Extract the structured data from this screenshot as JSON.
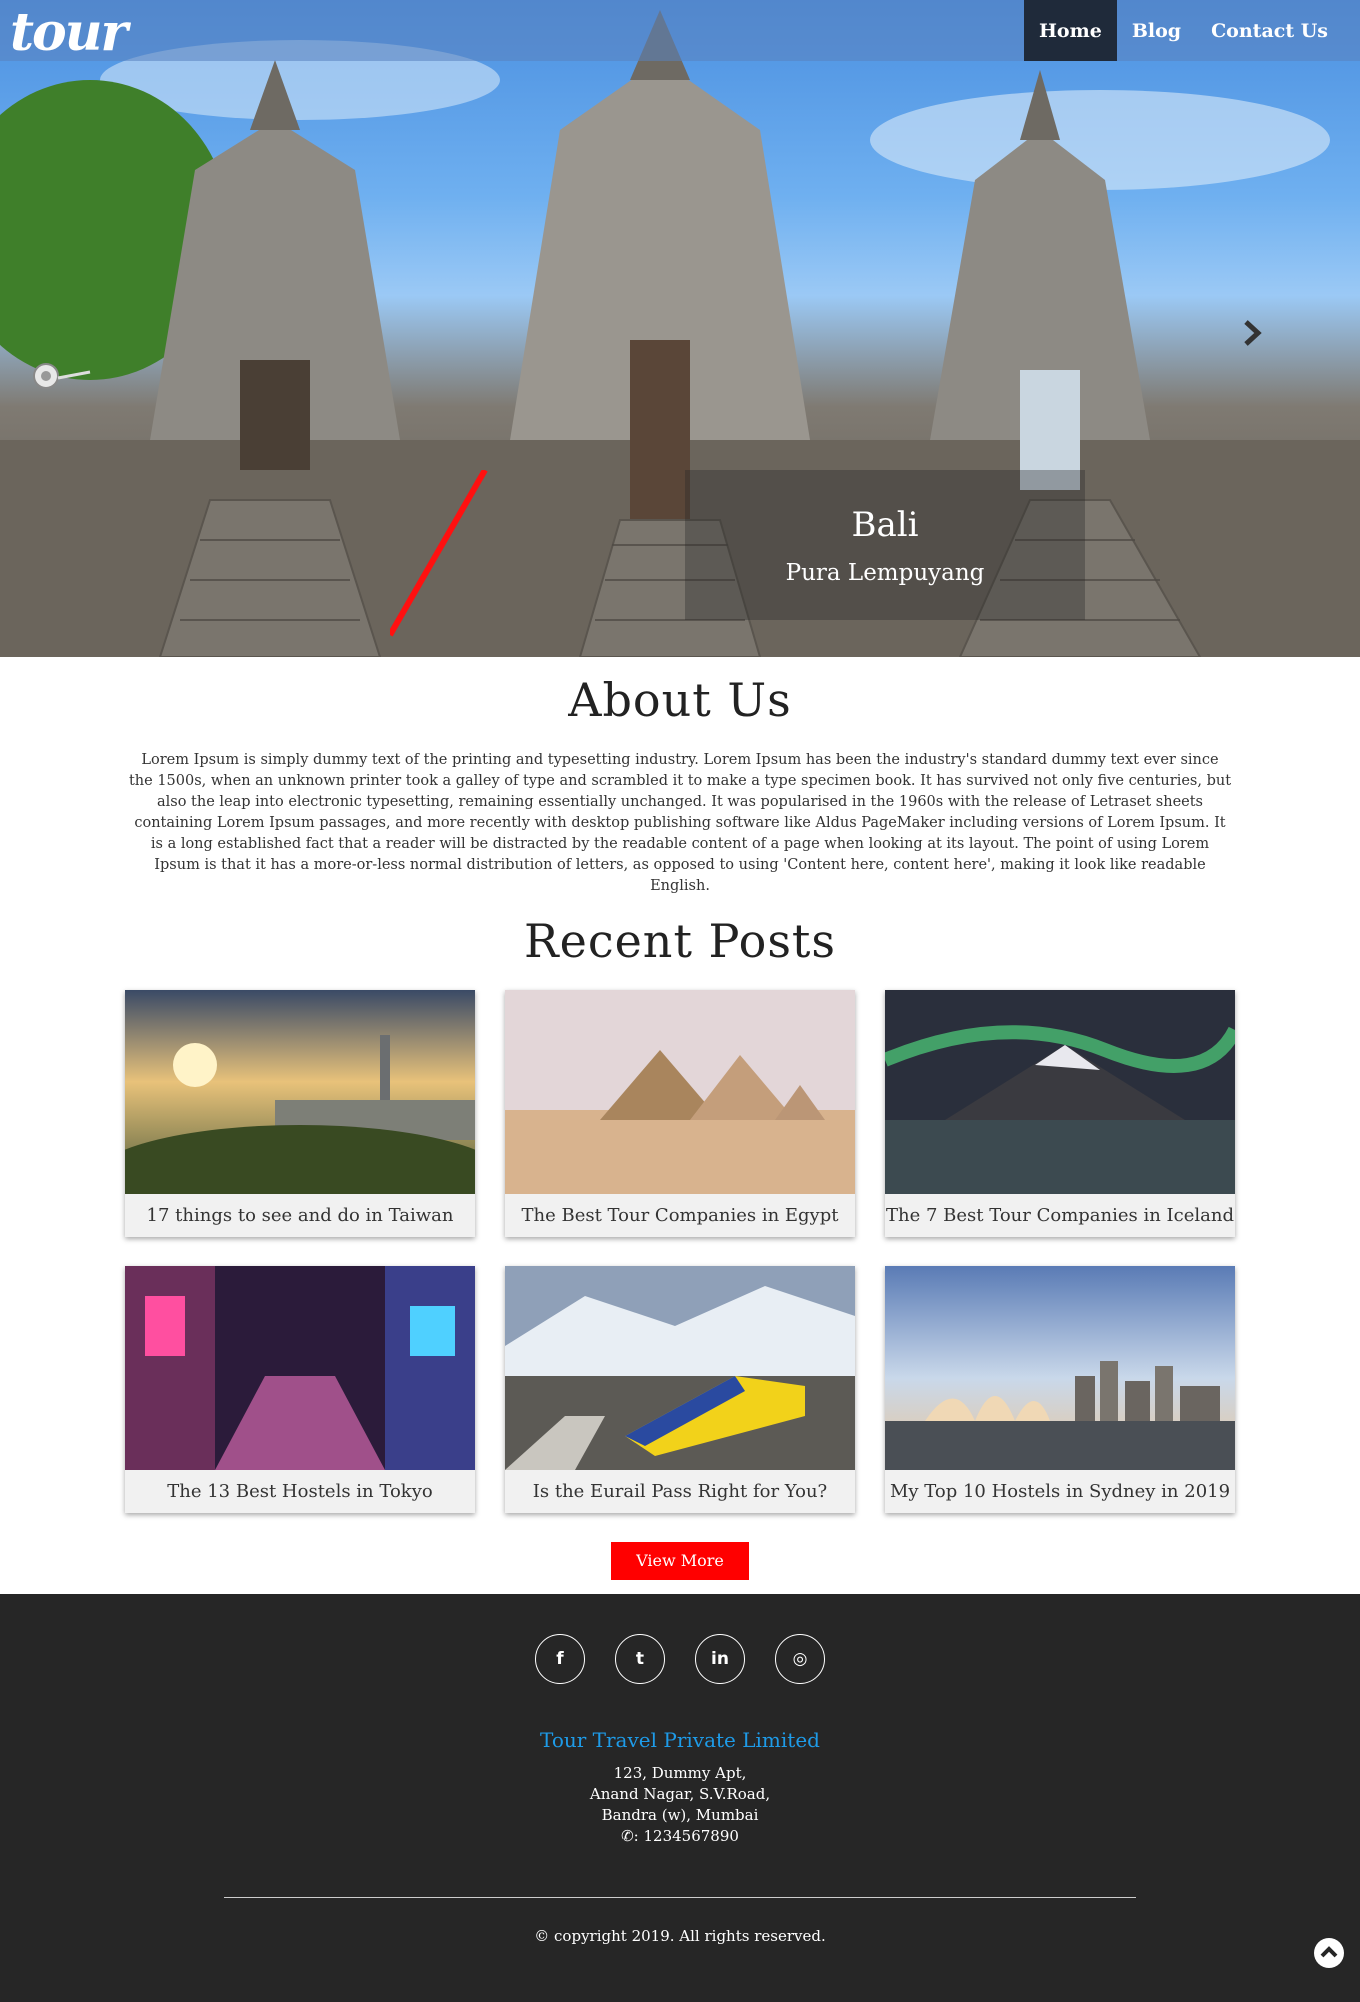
{
  "header": {
    "logo": "tour",
    "nav": [
      {
        "label": "Home"
      },
      {
        "label": "Blog"
      },
      {
        "label": "Contact Us"
      }
    ]
  },
  "hero": {
    "title": "Bali",
    "subtitle": "Pura Lempuyang"
  },
  "about": {
    "title": "About Us",
    "text": "Lorem Ipsum is simply dummy text of the printing and typesetting industry. Lorem Ipsum has been the industry's standard dummy text ever since the 1500s, when an unknown printer took a galley of type and scrambled it to make a type specimen book. It has survived not only five centuries, but also the leap into electronic typesetting, remaining essentially unchanged. It was popularised in the 1960s with the release of Letraset sheets containing Lorem Ipsum passages, and more recently with desktop publishing software like Aldus PageMaker including versions of Lorem Ipsum. It is a long established fact that a reader will be distracted by the readable content of a page when looking at its layout. The point of using Lorem Ipsum is that it has a more-or-less normal distribution of letters, as opposed to using 'Content here, content here', making it look like readable English."
  },
  "posts": {
    "title": "Recent Posts",
    "items": [
      {
        "title": "17 things to see and do in Taiwan"
      },
      {
        "title": "The Best Tour Companies in Egypt"
      },
      {
        "title": "The 7 Best Tour Companies in Iceland"
      },
      {
        "title": "The 13 Best Hostels in Tokyo"
      },
      {
        "title": "Is the Eurail Pass Right for You?"
      },
      {
        "title": "My Top 10 Hostels in Sydney in 2019"
      }
    ],
    "view_more": "View More"
  },
  "footer": {
    "social": [
      {
        "icon": "facebook-icon",
        "glyph": "f"
      },
      {
        "icon": "twitter-icon",
        "glyph": "t"
      },
      {
        "icon": "linkedin-icon",
        "glyph": "in"
      },
      {
        "icon": "instagram-icon",
        "glyph": "◎"
      }
    ],
    "company": "Tour Travel Private Limited",
    "address": [
      "123, Dummy Apt,",
      "Anand Nagar, S.V.Road,",
      "Bandra (w), Mumbai"
    ],
    "phone": ": 1234567890",
    "copyright": "© copyright 2019. All rights reserved."
  },
  "colors": {
    "accent": "#ff0000",
    "nav_active": "#1f2a3a",
    "footer_bg": "#262626",
    "company": "#1e9be8"
  }
}
